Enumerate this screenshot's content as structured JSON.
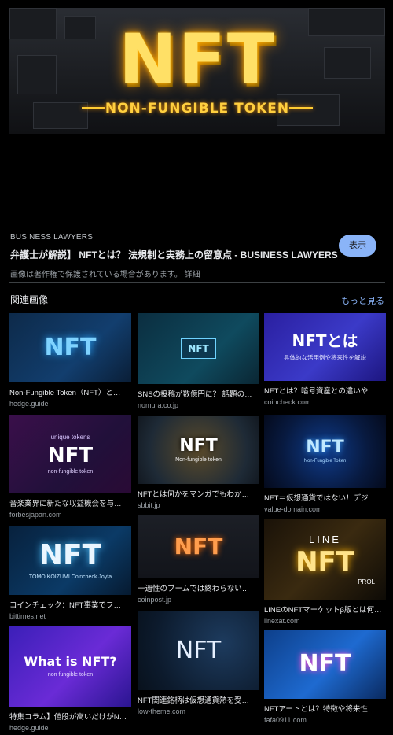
{
  "preview": {
    "image_text_main": "NFT",
    "image_text_sub": "NON-FUNGIBLE TOKEN",
    "source": "BUSINESS LAWYERS",
    "title": "弁護士が解説】 NFTとは？ 法規制と実務上の留意点 - BUSINESS LAWYERS",
    "copyright_note": "画像は著作権で保護されている場合があります。",
    "detail_link": "詳細",
    "visit_label": "表示"
  },
  "related": {
    "heading": "関連画像",
    "more_label": "もっと見る",
    "items": [
      {
        "title": "Non-Fungible Token（NFT）と…",
        "domain": "hedge.guide",
        "thumb_text": "NFT",
        "thumb_sub": ""
      },
      {
        "title": "SNSの投稿が数億円に？ 話題の…",
        "domain": "nomura.co.jp",
        "thumb_text": "NFT",
        "thumb_sub": ""
      },
      {
        "title": "NFTとは？暗号資産との違いや…",
        "domain": "coincheck.com",
        "thumb_text": "NFTとは",
        "thumb_sub": "具体的な活用例や将来性を解説"
      },
      {
        "title": "音楽業界に新たな収益機会を与…",
        "domain": "forbesjapan.com",
        "thumb_text": "NFT",
        "thumb_sub": "non-fungible token",
        "thumb_top": "unique tokens"
      },
      {
        "title": "NFTとは何かをマンガでもわか…",
        "domain": "sbbit.jp",
        "thumb_text": "NFT",
        "thumb_sub": "Non-fungible token"
      },
      {
        "title": "NFT＝仮想通貨ではない！デジ…",
        "domain": "value-domain.com",
        "thumb_text": "NFT",
        "thumb_sub": "Non-Fungible Token"
      },
      {
        "title": "コインチェック：NFT事業でフ…",
        "domain": "bittimes.net",
        "thumb_text": "NFT",
        "thumb_sub": "TOMO KOIZUMI  Coincheck  Joyfa"
      },
      {
        "title": "一過性のブームでは終わらない…",
        "domain": "coinpost.jp",
        "thumb_text": "NFT",
        "thumb_sub": ""
      },
      {
        "title": "LINEのNFTマーケットβ版とは何…",
        "domain": "linexat.com",
        "thumb_text": "NFT",
        "thumb_sub": "PROL",
        "thumb_top": "LINE"
      },
      {
        "title": "特集コラム】値段が高いだけがN…",
        "domain": "hedge.guide",
        "thumb_text": "What is NFT?",
        "thumb_sub": "non fungible token"
      },
      {
        "title": "NFT関連銘柄は仮想通貨熱を受…",
        "domain": "low-theme.com",
        "thumb_text": "NFT",
        "thumb_sub": ""
      },
      {
        "title": "NFTアートとは？特徴や将来性…",
        "domain": "fafa0911.com",
        "thumb_text": "NFT",
        "thumb_sub": ""
      }
    ]
  },
  "colors": {
    "accent": "#8ab4f8",
    "background": "#000000",
    "text": "#e8eaed",
    "muted": "#9aa0a6"
  }
}
